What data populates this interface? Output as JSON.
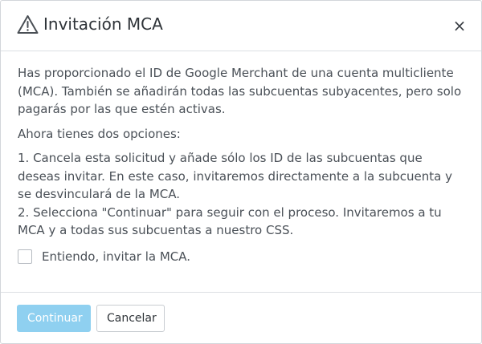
{
  "dialog": {
    "title": "Invitación MCA",
    "title_icon": "warning-triangle-icon",
    "close_label": "×",
    "close_icon": "close-icon"
  },
  "content": {
    "intro": "Has proporcionado el ID de Google Merchant de una cuenta multicliente (MCA). También se añadirán todas las subcuentas subyacentes, pero solo pagarás por las que estén activas.",
    "options_heading": "Ahora tienes dos opciones:",
    "option_1": "1. Cancela esta solicitud y añade sólo los ID de las subcuentas que deseas invitar. En este caso, invitaremos directamente a la subcuenta y se desvinculará de la MCA.",
    "option_2": "2. Selecciona \"Continuar\" para seguir con el proceso. Invitaremos a tu MCA y a todas sus subcuentas a nuestro CSS."
  },
  "agreement": {
    "checked": false,
    "label": "Entiendo, invitar la MCA."
  },
  "footer": {
    "continue_label": "Continuar",
    "continue_disabled": true,
    "cancel_label": "Cancelar"
  },
  "colors": {
    "primary_disabled": "#8fd0f0",
    "border": "#dcdfe3",
    "text": "#4a5057"
  }
}
